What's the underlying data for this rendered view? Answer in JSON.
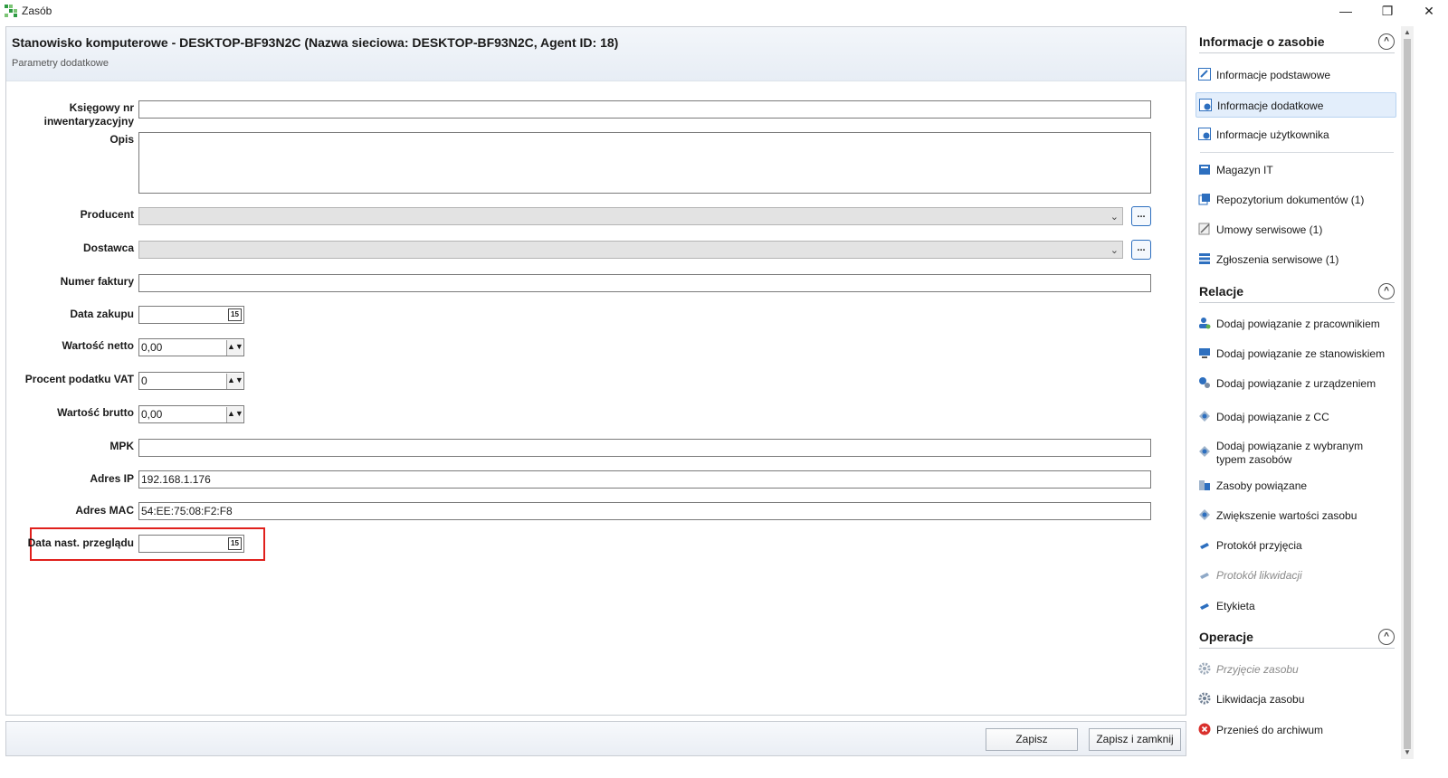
{
  "window": {
    "title": "Zasób",
    "controls": {
      "minimize": "—",
      "maximize": "❐",
      "close": "✕"
    }
  },
  "form": {
    "title": "Stanowisko komputerowe - DESKTOP-BF93N2C (Nazwa sieciowa: DESKTOP-BF93N2C, Agent ID: 18)",
    "subtitle": "Parametry dodatkowe",
    "fields": {
      "ksiegowy_label": "Księgowy nr inwentaryzacyjny",
      "ksiegowy_value": "",
      "opis_label": "Opis",
      "opis_value": "",
      "producent_label": "Producent",
      "producent_value": "",
      "dostawca_label": "Dostawca",
      "dostawca_value": "",
      "ellipsis": "...",
      "numer_faktury_label": "Numer faktury",
      "numer_faktury_value": "",
      "data_zakupu_label": "Data zakupu",
      "data_zakupu_value": "  -  -",
      "wartosc_netto_label": "Wartość netto",
      "wartosc_netto_value": "0,00",
      "procent_vat_label": "Procent podatku VAT",
      "procent_vat_value": "0",
      "wartosc_brutto_label": "Wartość brutto",
      "wartosc_brutto_value": "0,00",
      "mpk_label": "MPK",
      "mpk_value": "",
      "adres_ip_label": "Adres IP",
      "adres_ip_value": "192.168.1.176",
      "adres_mac_label": "Adres MAC",
      "adres_mac_value": "54:EE:75:08:F2:F8",
      "data_przegladu_label": "Data nast. przeglądu",
      "data_przegladu_value": "  -  -",
      "calendar_glyph": "15"
    }
  },
  "buttons": {
    "save": "Zapisz",
    "save_close": "Zapisz i zamknij"
  },
  "sidebar": {
    "info_section": {
      "title": "Informacje o zasobie",
      "items": [
        {
          "label": "Informacje podstawowe",
          "icon": "edit-info-icon"
        },
        {
          "label": "Informacje dodatkowe",
          "icon": "edit-info-icon"
        },
        {
          "label": "Informacje użytkownika",
          "icon": "edit-info-icon"
        },
        {
          "label": "Magazyn IT",
          "icon": "warehouse-icon"
        },
        {
          "label": "Repozytorium dokumentów (1)",
          "icon": "documents-icon"
        },
        {
          "label": "Umowy serwisowe (1)",
          "icon": "contract-icon"
        },
        {
          "label": "Zgłoszenia serwisowe (1)",
          "icon": "tickets-icon"
        }
      ]
    },
    "relations_section": {
      "title": "Relacje",
      "items": [
        {
          "label": "Dodaj powiązanie z pracownikiem",
          "icon": "user-link-icon"
        },
        {
          "label": "Dodaj powiązanie ze stanowiskiem",
          "icon": "workstation-link-icon"
        },
        {
          "label": "Dodaj powiązanie z urządzeniem",
          "icon": "device-link-icon"
        },
        {
          "label": "Dodaj powiązanie z CC",
          "icon": "cc-link-icon"
        },
        {
          "label": "Dodaj powiązanie z wybranym typem zasobów",
          "icon": "asset-type-link-icon"
        },
        {
          "label": "Zasoby powiązane",
          "icon": "related-assets-icon"
        },
        {
          "label": "Zwiększenie wartości zasobu",
          "icon": "value-increase-icon"
        },
        {
          "label": "Protokół przyjęcia",
          "icon": "protocol-icon"
        },
        {
          "label": "Protokół likwidacji",
          "icon": "protocol-icon"
        },
        {
          "label": "Etykieta",
          "icon": "label-icon"
        }
      ]
    },
    "operations_section": {
      "title": "Operacje",
      "items": [
        {
          "label": "Przyjęcie zasobu",
          "icon": "gear-icon"
        },
        {
          "label": "Likwidacja zasobu",
          "icon": "gear-icon"
        },
        {
          "label": "Przenieś do archiwum",
          "icon": "error-icon"
        }
      ]
    },
    "collapse_glyph": "^"
  },
  "colors": {
    "accent": "#2d6fbf",
    "highlight": "#e0201c",
    "error": "#d9302c"
  }
}
